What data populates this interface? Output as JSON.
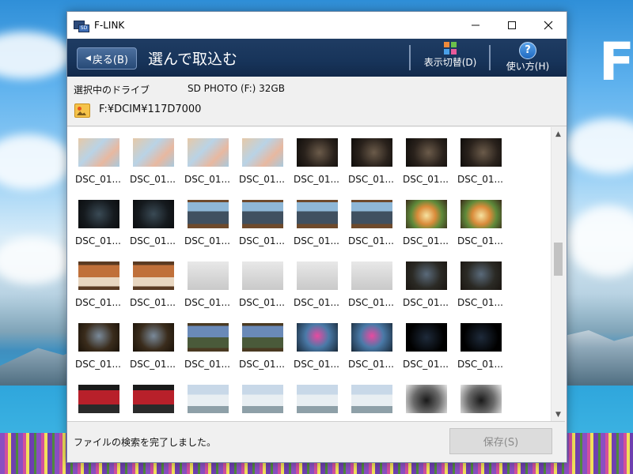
{
  "window": {
    "title": "F-LINK"
  },
  "background": {
    "letters": "F"
  },
  "toolbar": {
    "back_label": "戻る(B)",
    "page_title": "選んで取込む",
    "view_toggle_label": "表示切替(D)",
    "help_label": "使い方(H)"
  },
  "drive": {
    "selected_label": "選択中のドライブ",
    "drive_name": "SD PHOTO (F:) 32GB",
    "path": "F:¥DCIM¥117D7000"
  },
  "thumbnails": {
    "label": "DSC_01...",
    "rows": [
      [
        "map",
        "map",
        "map",
        "map",
        "dark-hand",
        "dark-hand",
        "dark-hand",
        "dark-hand"
      ],
      [
        "phone",
        "phone",
        "city",
        "city",
        "city",
        "city",
        "food",
        "food"
      ],
      [
        "pets",
        "pets",
        "note",
        "note",
        "note",
        "note",
        "tv-dark",
        "tv-dark"
      ],
      [
        "tv-room",
        "tv-room",
        "tv-landscape",
        "tv-landscape",
        "portrait-pink",
        "portrait-pink",
        "black",
        "black"
      ],
      [
        "red-screen",
        "red-screen",
        "building",
        "building",
        "building",
        "building",
        "car",
        "car"
      ]
    ]
  },
  "status": {
    "message": "ファイルの検索を完了しました。",
    "save_label": "保存(S)"
  },
  "colors": {
    "toolbar_bg": "#17345a",
    "save_disabled_bg": "#dcdcdc"
  }
}
